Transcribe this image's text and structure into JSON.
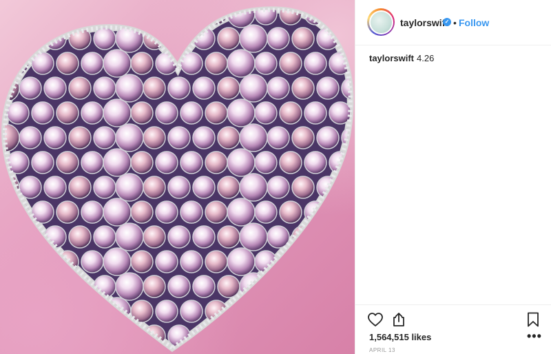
{
  "post": {
    "image_alt_icon": "jeweled-heart-image"
  },
  "header": {
    "username": "taylorswift",
    "verified_icon": "verified-badge-icon",
    "verified_glyph": "✓",
    "separator": "•",
    "follow_label": "Follow"
  },
  "caption": {
    "username": "taylorswift",
    "text": "4.26"
  },
  "actions": {
    "like_icon": "heart-icon",
    "share_icon": "share-icon",
    "save_icon": "bookmark-icon",
    "more_label": "•••"
  },
  "stats": {
    "likes": "1,564,515 likes",
    "date": "APRIL 13"
  },
  "colors": {
    "link_blue": "#3897f0",
    "text": "#262626",
    "muted": "#999999"
  }
}
